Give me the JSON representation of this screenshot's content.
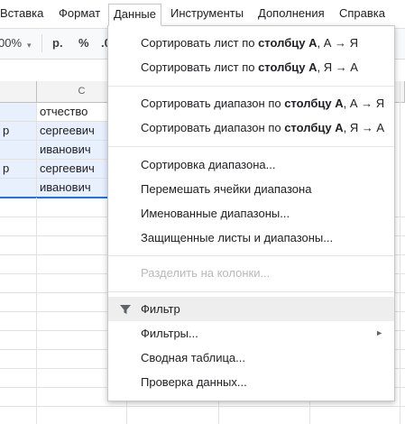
{
  "menubar": {
    "items": [
      "Вставка",
      "Формат",
      "Данные",
      "Инструменты",
      "Дополнения",
      "Справка"
    ]
  },
  "toolbar": {
    "zoom": "00%",
    "currency": "р.",
    "percent": "%",
    "decimal": ".0"
  },
  "grid": {
    "column_c_header": "C",
    "column_c_cells": [
      "отчество",
      "сергеевич",
      "иванович",
      "сергеевич",
      "иванович"
    ],
    "column_b_cells": [
      "",
      "р",
      "",
      "р",
      ""
    ]
  },
  "menu": {
    "sort_sheet_az": {
      "prefix": "Сортировать лист по ",
      "bold": "столбцу A",
      "suffix": ", А → Я"
    },
    "sort_sheet_za": {
      "prefix": "Сортировать лист по ",
      "bold": "столбцу A",
      "suffix": ", Я → А"
    },
    "sort_range_az": {
      "prefix": "Сортировать диапазон по ",
      "bold": "столбцу A",
      "suffix": ", А → Я"
    },
    "sort_range_za": {
      "prefix": "Сортировать диапазон по ",
      "bold": "столбцу A",
      "suffix": ", Я → А"
    },
    "sort_range": "Сортировка диапазона...",
    "shuffle": "Перемешать ячейки диапазона",
    "named_ranges": "Именованные диапазоны...",
    "protected": "Защищенные листы и диапазоны...",
    "split": "Разделить на колонки...",
    "filter": "Фильтр",
    "filters": "Фильтры...",
    "pivot": "Сводная таблица...",
    "validation": "Проверка данных..."
  }
}
